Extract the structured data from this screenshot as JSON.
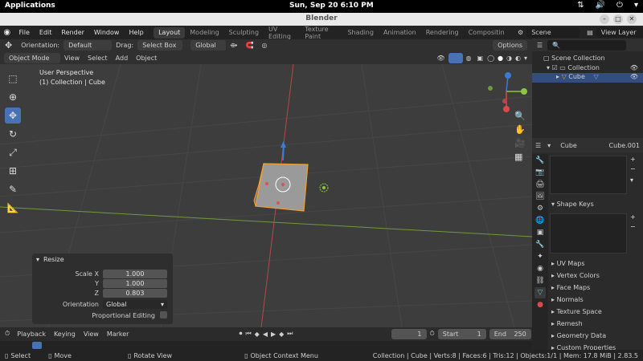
{
  "system": {
    "apps_label": "Applications",
    "clock": "Sun, Sep 20   6:10 PM"
  },
  "window": {
    "title": "Blender"
  },
  "menu": {
    "items": [
      "File",
      "Edit",
      "Render",
      "Window",
      "Help"
    ]
  },
  "workspaces": [
    "Layout",
    "Modeling",
    "Sculpting",
    "UV Editing",
    "Texture Paint",
    "Shading",
    "Animation",
    "Rendering",
    "Compositin"
  ],
  "scene": {
    "label": "Scene"
  },
  "view_layer": {
    "label": "View Layer"
  },
  "toolheader": {
    "orientation_label": "Orientation:",
    "orientation_value": "Default",
    "drag_label": "Drag:",
    "drag_value": "Select Box",
    "transform_value": "Global",
    "options": "Options"
  },
  "header": {
    "mode": "Object Mode",
    "items": [
      "View",
      "Select",
      "Add",
      "Object"
    ]
  },
  "viewport": {
    "perspective": "User Perspective",
    "collection": "(1) Collection | Cube"
  },
  "redo_panel": {
    "title": "Resize",
    "scale_x_label": "Scale X",
    "scale_x": "1.000",
    "y_label": "Y",
    "y": "1.000",
    "z_label": "Z",
    "z": "0.803",
    "orientation_label": "Orientation",
    "orientation_value": "Global",
    "proportional_label": "Proportional Editing"
  },
  "outliner": {
    "scene_collection": "Scene Collection",
    "collection": "Collection",
    "cube": "Cube"
  },
  "properties": {
    "object_name": "Cube",
    "mesh_name": "Cube.001",
    "panels": [
      "Shape Keys",
      "UV Maps",
      "Vertex Colors",
      "Face Maps",
      "Normals",
      "Texture Space",
      "Remesh",
      "Geometry Data",
      "Custom Properties"
    ]
  },
  "timeline": {
    "playback": "Playback",
    "keying": "Keying",
    "view": "View",
    "marker": "Marker",
    "current_frame": "1",
    "start_label": "Start",
    "start": "1",
    "end_label": "End",
    "end": "250"
  },
  "status": {
    "select": "Select",
    "move": "Move",
    "rotate": "Rotate View",
    "context": "Object Context Menu",
    "stats": "Collection | Cube | Verts:8 | Faces:6 | Tris:12 | Objects:1/1 | Mem: 17.8 MiB | 2.83.5"
  },
  "colors": {
    "accent": "#4772b3",
    "selection": "#f0a030",
    "x_axis": "#d94a4a",
    "y_axis": "#8cc63f",
    "z_axis": "#3a7bd5"
  }
}
